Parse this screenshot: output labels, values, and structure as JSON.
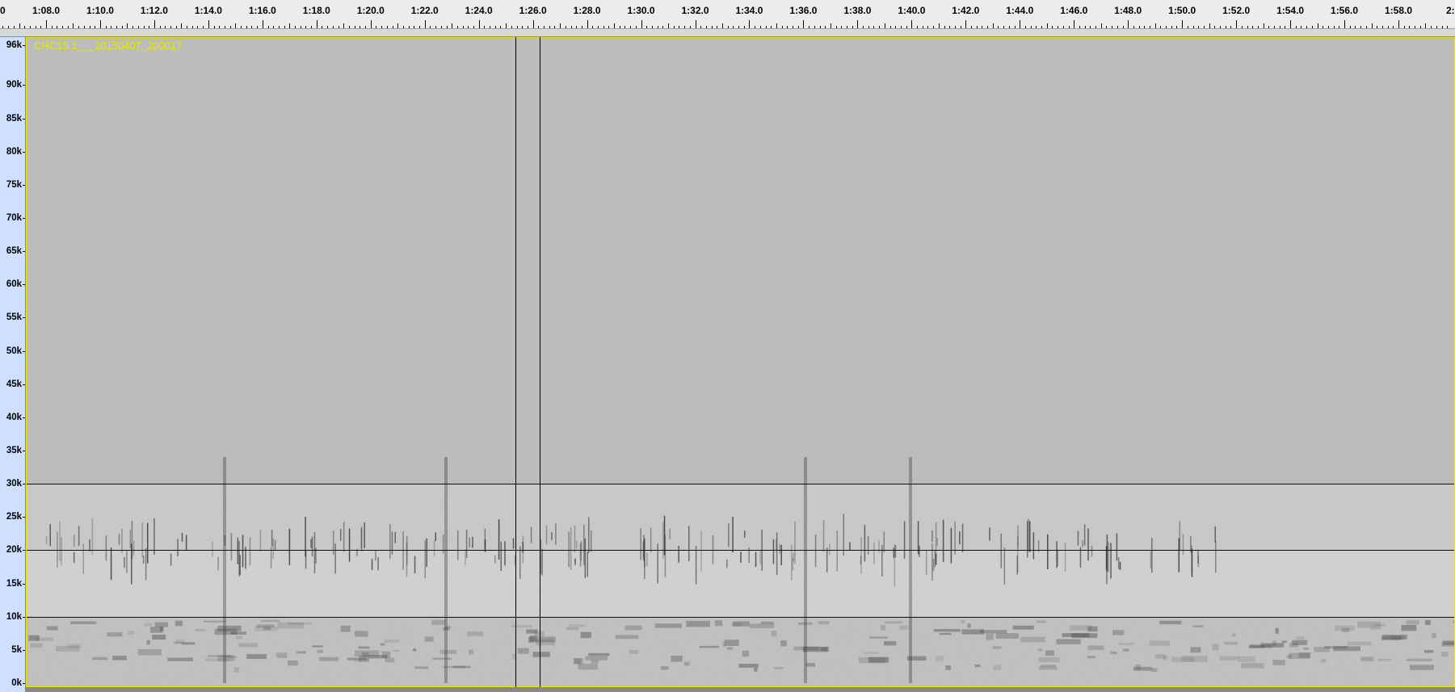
{
  "timeline": {
    "labels": [
      "0",
      "1:08.0",
      "1:10.0",
      "1:12.0",
      "1:14.0",
      "1:16.0",
      "1:18.0",
      "1:20.0",
      "1:22.0",
      "1:24.0",
      "1:26.0",
      "1:28.0",
      "1:30.0",
      "1:32.0",
      "1:34.0",
      "1:36.0",
      "1:38.0",
      "1:40.0",
      "1:42.0",
      "1:44.0",
      "1:46.0",
      "1:48.0",
      "1:50.0",
      "1:52.0",
      "1:54.0",
      "1:56.0",
      "1:58.0",
      "2:"
    ]
  },
  "track": {
    "name": "CHC15.1___20150407_200017"
  },
  "frequency_axis": {
    "labels": [
      "96k",
      "90k",
      "85k",
      "80k",
      "75k",
      "70k",
      "65k",
      "60k",
      "55k",
      "50k",
      "45k",
      "40k",
      "35k",
      "30k",
      "25k",
      "20k",
      "15k",
      "10k",
      "5k",
      "0k"
    ]
  },
  "colors": {
    "ruler_bg": "#ececec",
    "vruler_bg": "#cfe0ff",
    "spectrogram_bg": "#b9b9b9",
    "track_name": "#e8e800"
  }
}
